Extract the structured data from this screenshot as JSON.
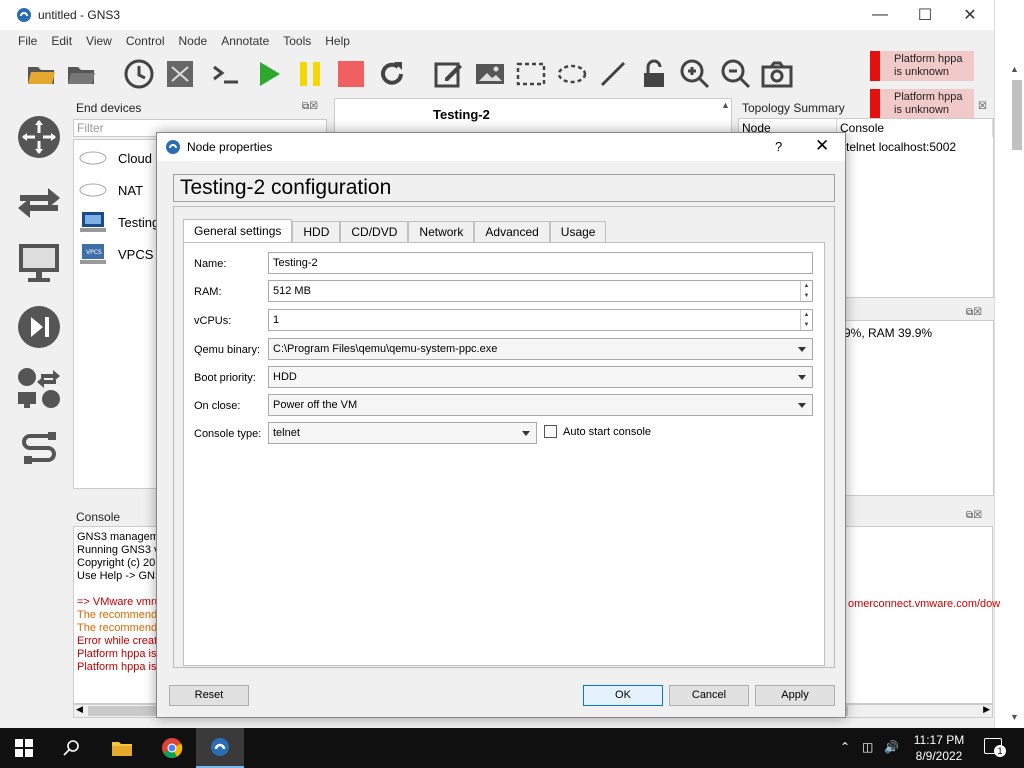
{
  "window": {
    "title": "untitled - GNS3"
  },
  "menu": [
    "File",
    "Edit",
    "View",
    "Control",
    "Node",
    "Annotate",
    "Tools",
    "Help"
  ],
  "notifications": [
    "Platform hppa is unknown",
    "Platform hppa is unknown"
  ],
  "end_devices": {
    "title": "End devices",
    "filter_placeholder": "Filter",
    "items": [
      {
        "label": "Cloud"
      },
      {
        "label": "NAT"
      },
      {
        "label": "Testing"
      },
      {
        "label": "VPCS"
      }
    ]
  },
  "canvas": {
    "node_label": "Testing-2"
  },
  "topology": {
    "title": "Topology Summary",
    "col_node": "Node",
    "col_console": "Console",
    "console_value": "telnet localhost:5002"
  },
  "resources": {
    "text": "9%, RAM 39.9%"
  },
  "console": {
    "title": "Console",
    "lines": [
      {
        "text": "GNS3 manageme",
        "color": "#000000"
      },
      {
        "text": "Running GNS3 ve",
        "color": "#000000"
      },
      {
        "text": "Copyright (c) 20",
        "color": "#000000"
      },
      {
        "text": "Use Help -> GNS",
        "color": "#000000"
      },
      {
        "text": "",
        "color": "#000000"
      },
      {
        "text": "=> VMware vmru",
        "color": "#c00000"
      },
      {
        "text": "The recommende",
        "color": "#d86a00"
      },
      {
        "text": "The recommende",
        "color": "#d86a00"
      },
      {
        "text": "Error while creat",
        "color": "#c00000"
      },
      {
        "text": "Platform hppa is",
        "color": "#c00000"
      },
      {
        "text": "Platform hppa is",
        "color": "#c00000"
      }
    ],
    "url_fragment": "omerconnect.vmware.com/dow"
  },
  "dialog": {
    "title": "Node properties",
    "help": "?",
    "header": "Testing-2 configuration",
    "tabs": [
      "General settings",
      "HDD",
      "CD/DVD",
      "Network",
      "Advanced",
      "Usage"
    ],
    "fields": {
      "name_label": "Name:",
      "name_value": "Testing-2",
      "ram_label": "RAM:",
      "ram_value": "512 MB",
      "vcpus_label": "vCPUs:",
      "vcpus_value": "1",
      "qemu_label": "Qemu binary:",
      "qemu_value": "C:\\Program Files\\qemu\\qemu-system-ppc.exe",
      "boot_label": "Boot priority:",
      "boot_value": "HDD",
      "onclose_label": "On close:",
      "onclose_value": "Power off the VM",
      "console_label": "Console type:",
      "console_value": "telnet",
      "autostart_label": "Auto start console"
    },
    "buttons": {
      "reset": "Reset",
      "ok": "OK",
      "cancel": "Cancel",
      "apply": "Apply"
    }
  },
  "taskbar": {
    "time": "11:17 PM",
    "date": "8/9/2022",
    "notif_count": "1"
  },
  "colors": {
    "notif_red": "#e41010",
    "notif_bg": "#f2c9c9",
    "accent": "#0078d7",
    "play_green": "#2ea82e",
    "pause_yellow": "#f5d800",
    "stop_red": "#f06060"
  }
}
